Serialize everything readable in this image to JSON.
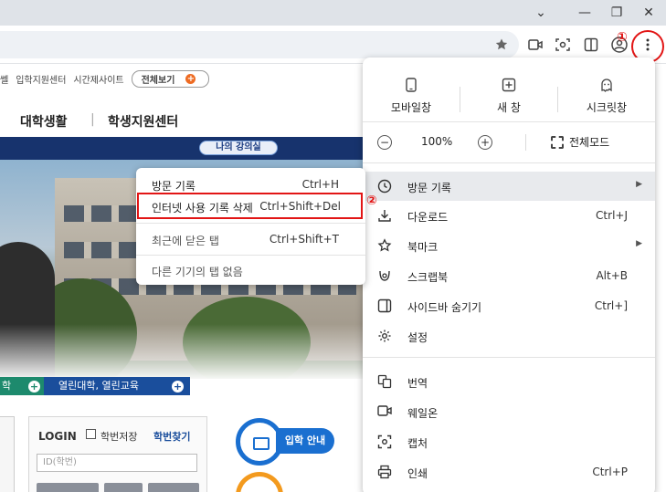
{
  "browser": {
    "window_controls": {
      "tab_list": "⌄",
      "minimize": "—",
      "restore": "❐",
      "close": "✕"
    },
    "toolbar_icons": [
      "bookmark-star-icon",
      "cast-icon",
      "screenshot-icon",
      "split-view-icon",
      "profile-icon",
      "menu-kebab-icon"
    ],
    "markers": {
      "one": "①",
      "two": "②"
    },
    "accent_color": "#e21515"
  },
  "page": {
    "top_links": [
      "쎌",
      "입학지원센터",
      "시간제사이트"
    ],
    "all_view": "전체보기",
    "nav": {
      "item1": "대학생활",
      "separator": "|",
      "item2": "학생지원센터"
    },
    "my_lecture": "나의 강의실",
    "tab_green": "학",
    "tab_blue": "열린대학, 열린교육",
    "login": {
      "title": "LOGIN",
      "remember": "학번저장",
      "find_id": "학번찾기",
      "id_placeholder": "ID(학번)"
    },
    "admission_label": "입학 안내",
    "colors": {
      "navy": "#17336d",
      "blue": "#1a4e9c",
      "green": "#1d8a6d",
      "orange": "#ee6b22"
    }
  },
  "menu": {
    "top_buttons": [
      {
        "label": "모바일창",
        "icon": "mobile-icon"
      },
      {
        "label": "새 창",
        "icon": "new-window-icon"
      },
      {
        "label": "시크릿창",
        "icon": "incognito-icon"
      }
    ],
    "zoom": {
      "minus": "−",
      "value": "100%",
      "plus": "+",
      "fullscreen": "전체모드"
    },
    "items": [
      {
        "label": "방문 기록",
        "shortcut": "",
        "submenu": true,
        "icon": "history-icon"
      },
      {
        "label": "다운로드",
        "shortcut": "Ctrl+J",
        "submenu": false,
        "icon": "download-icon"
      },
      {
        "label": "북마크",
        "shortcut": "",
        "submenu": true,
        "icon": "star-icon"
      },
      {
        "label": "스크랩북",
        "shortcut": "Alt+B",
        "submenu": false,
        "icon": "scrapbook-icon"
      },
      {
        "label": "사이드바 숨기기",
        "shortcut": "Ctrl+]",
        "submenu": false,
        "icon": "sidebar-icon"
      },
      {
        "label": "설정",
        "shortcut": "",
        "submenu": false,
        "icon": "gear-icon"
      },
      {
        "label": "번역",
        "shortcut": "",
        "submenu": false,
        "icon": "translate-icon"
      },
      {
        "label": "웨일온",
        "shortcut": "",
        "submenu": false,
        "icon": "whale-on-icon"
      },
      {
        "label": "캡처",
        "shortcut": "",
        "submenu": false,
        "icon": "capture-icon"
      },
      {
        "label": "인쇄",
        "shortcut": "Ctrl+P",
        "submenu": false,
        "icon": "print-icon"
      }
    ]
  },
  "history_submenu": {
    "items": [
      {
        "label": "방문 기록",
        "shortcut": "Ctrl+H"
      },
      {
        "label": "인터넷 사용 기록 삭제",
        "shortcut": "Ctrl+Shift+Del"
      },
      {
        "label": "최근에 닫은 탭",
        "shortcut": "Ctrl+Shift+T"
      },
      {
        "label": "다른 기기의 탭 없음",
        "shortcut": ""
      }
    ]
  }
}
